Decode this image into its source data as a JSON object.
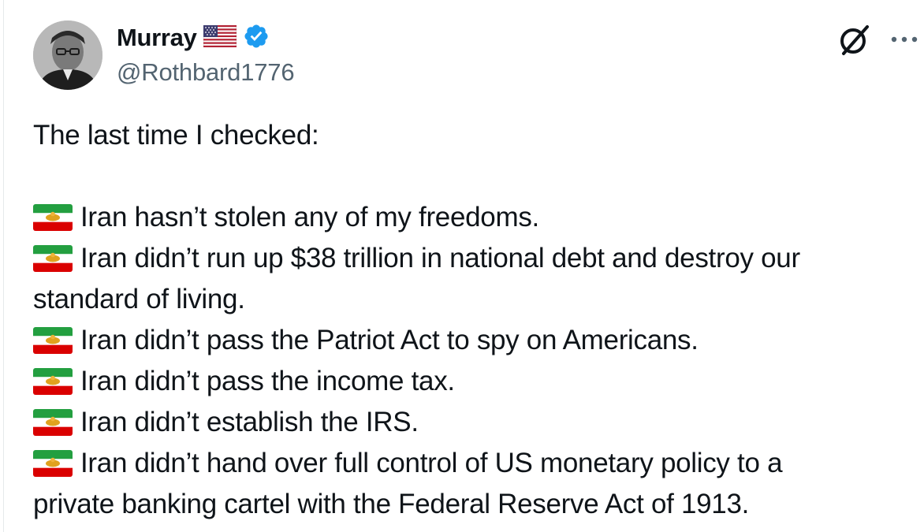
{
  "author": {
    "display_name": "Murray",
    "handle": "@Rothbard1776",
    "avatar_icon": "portrait-avatar",
    "name_flag_icon": "us-flag-icon",
    "verified_icon": "verified-badge-icon",
    "verified_color": "#1d9bf0"
  },
  "actions": {
    "grok_icon": "grok-icon",
    "more_icon": "more-options-icon"
  },
  "tweet": {
    "intro": "The last time I checked:",
    "bullet_icon": "iran-lion-and-sun-flag-icon",
    "items": [
      {
        "line1": "Iran hasn’t stolen any of my freedoms.",
        "line2": ""
      },
      {
        "line1": "Iran didn’t run up $38 trillion in national debt and destroy our",
        "line2": "standard of living."
      },
      {
        "line1": "Iran didn’t pass the Patriot Act to spy on Americans.",
        "line2": ""
      },
      {
        "line1": "Iran didn’t pass the income tax.",
        "line2": ""
      },
      {
        "line1": "Iran didn’t establish the IRS.",
        "line2": ""
      },
      {
        "line1": "Iran didn’t hand over full control of US monetary policy to a",
        "line2": "private banking cartel with the Federal Reserve Act of 1913."
      }
    ]
  },
  "colors": {
    "text": "#0f1419",
    "secondary": "#536471",
    "flag_green": "#239f40",
    "flag_red": "#da0000",
    "flag_emblem": "#e0a21f"
  }
}
